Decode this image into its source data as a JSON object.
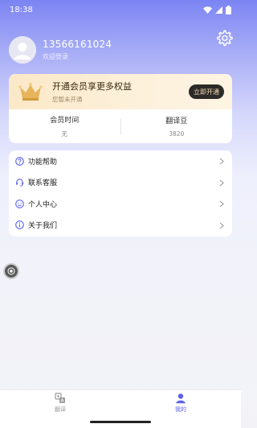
{
  "status_bar": {
    "time": "18:38"
  },
  "profile": {
    "username": "13566161024",
    "subtitle": "欢迎登录"
  },
  "vip": {
    "title": "开通会员享更多权益",
    "subtitle": "您暂未开通",
    "button_label": "立即开通",
    "stats": [
      {
        "label": "会员时间",
        "value": "无"
      },
      {
        "label": "翻译豆",
        "value": "3820"
      }
    ]
  },
  "menu": {
    "items": [
      {
        "label": "功能帮助",
        "icon": "help-icon"
      },
      {
        "label": "联系客服",
        "icon": "headset-icon"
      },
      {
        "label": "个人中心",
        "icon": "smiley-icon"
      },
      {
        "label": "关于我们",
        "icon": "info-icon"
      }
    ]
  },
  "tabbar": {
    "tabs": [
      {
        "label": "翻译",
        "icon": "translate-icon",
        "active": false
      },
      {
        "label": "我的",
        "icon": "user-icon",
        "active": true
      }
    ]
  },
  "colors": {
    "accent": "#5b63e8",
    "vip_button": "#2c2a28"
  }
}
